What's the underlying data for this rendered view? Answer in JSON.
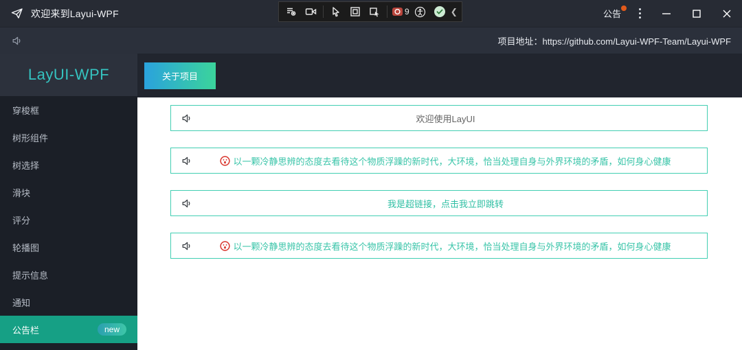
{
  "titlebar": {
    "title": "欢迎来到Layui-WPF",
    "announcement_label": "公告",
    "debug_toolbar": {
      "badge_count": "9",
      "icons": [
        "element-inspector-icon",
        "screen-record-icon",
        "select-element-icon",
        "display-layout-icon",
        "select-region-icon",
        "record-badge-icon",
        "accessibility-icon",
        "status-check-icon",
        "collapse-chevron-icon"
      ]
    }
  },
  "subheader": {
    "project_label": "项目地址：https://github.com/Layui-WPF-Team/Layui-WPF"
  },
  "sidebar": {
    "logo": "LayUI-WPF",
    "items": [
      {
        "label": "穿梭框"
      },
      {
        "label": "树形组件"
      },
      {
        "label": "树选择"
      },
      {
        "label": "滑块"
      },
      {
        "label": "评分"
      },
      {
        "label": "轮播图"
      },
      {
        "label": "提示信息"
      },
      {
        "label": "通知"
      },
      {
        "label": "公告栏",
        "badge": "new",
        "selected": true
      }
    ]
  },
  "main": {
    "tab_label": "关于项目",
    "notices": [
      {
        "type": "plain",
        "text": "欢迎使用LayUI"
      },
      {
        "type": "emoji",
        "text": "以一颗冷静思辨的态度去看待这个物质浮躁的新时代，大环境，恰当处理自身与外界环境的矛盾，如何身心健康"
      },
      {
        "type": "link",
        "text": "我是超链接，点击我立即跳转"
      },
      {
        "type": "emoji",
        "text": "以一颗冷静思辨的态度去看待这个物质浮躁的新时代，大环境，恰当处理自身与外界环境的矛盾，如何身心健康"
      }
    ]
  },
  "colors": {
    "accent_teal": "#16a085",
    "notice_border": "#41ceb2",
    "notice_text": "#38c4a8",
    "button_gradient_start": "#2aa2dd",
    "button_gradient_end": "#3bd49b",
    "titlebar_bg": "#272b34",
    "sidebar_bg": "#1b1f27",
    "announcement_dot": "#e25a1b"
  }
}
